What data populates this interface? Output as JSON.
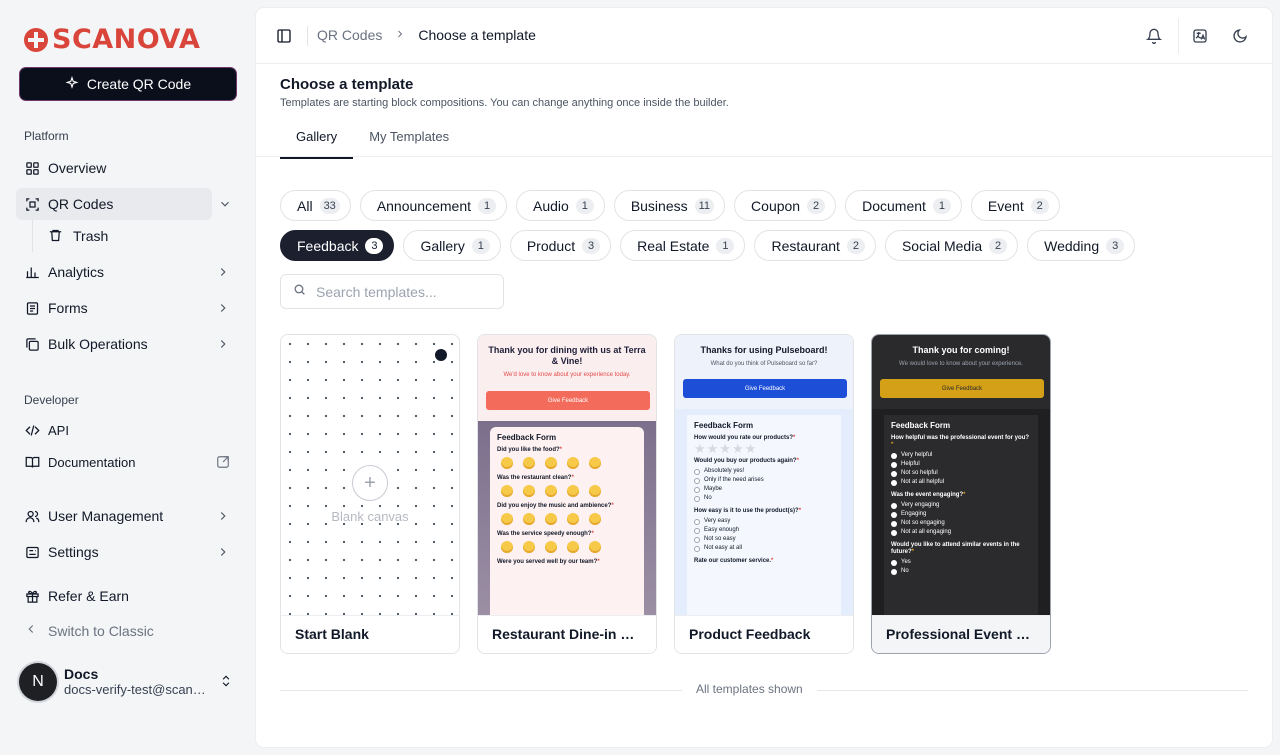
{
  "brand": {
    "name": "SCANOVA",
    "color": "#d9453a"
  },
  "sidebar": {
    "create_label": "Create QR Code",
    "platform_label": "Platform",
    "developer_label": "Developer",
    "items": {
      "overview": "Overview",
      "qr_codes": "QR Codes",
      "trash": "Trash",
      "analytics": "Analytics",
      "forms": "Forms",
      "bulk": "Bulk Operations",
      "api": "API",
      "docs": "Documentation",
      "users": "User Management",
      "settings": "Settings",
      "refer": "Refer & Earn",
      "switch": "Switch to Classic"
    },
    "user": {
      "initial": "N",
      "name": "Docs",
      "email": "docs-verify-test@scanova.io"
    }
  },
  "topbar": {
    "breadcrumb": {
      "parent": "QR Codes",
      "current": "Choose a template"
    }
  },
  "page": {
    "title": "Choose a template",
    "subtitle": "Templates are starting block compositions. You can change anything once inside the builder.",
    "tabs": [
      "Gallery",
      "My Templates"
    ]
  },
  "categories": [
    {
      "label": "All",
      "count": "33"
    },
    {
      "label": "Announcement",
      "count": "1"
    },
    {
      "label": "Audio",
      "count": "1"
    },
    {
      "label": "Business",
      "count": "11"
    },
    {
      "label": "Coupon",
      "count": "2"
    },
    {
      "label": "Document",
      "count": "1"
    },
    {
      "label": "Event",
      "count": "2"
    },
    {
      "label": "Feedback",
      "count": "3"
    },
    {
      "label": "Gallery",
      "count": "1"
    },
    {
      "label": "Product",
      "count": "3"
    },
    {
      "label": "Real Estate",
      "count": "1"
    },
    {
      "label": "Restaurant",
      "count": "2"
    },
    {
      "label": "Social Media",
      "count": "2"
    },
    {
      "label": "Wedding",
      "count": "3"
    }
  ],
  "search": {
    "placeholder": "Search templates..."
  },
  "cards": {
    "blank": {
      "name": "Start Blank",
      "label": "Blank canvas"
    },
    "restaurant": {
      "name": "Restaurant Dine-in Feedback",
      "title": "Thank you for dining with us at Terra & Vine!",
      "sub": "We'd love to know about your experience today.",
      "button": "Give Feedback",
      "form_title": "Feedback Form",
      "questions": [
        "Did you like the food?",
        "Was the restaurant clean?",
        "Did you enjoy the music and ambience?",
        "Was the service speedy enough?",
        "Were you served well by our team?"
      ],
      "accent": "#f26b5b"
    },
    "product": {
      "name": "Product Feedback",
      "title": "Thanks for using Pulseboard!",
      "sub": "What do you think of Pulseboard so far?",
      "button": "Give Feedback",
      "form_title": "Feedback Form",
      "q1": "How would you rate our products?",
      "q2": "Would you buy our products again?",
      "q2_opts": [
        "Absolutely yes!",
        "Only if the need arises",
        "Maybe",
        "No"
      ],
      "q3": "How easy is it to use the product(s)?",
      "q3_opts": [
        "Very easy",
        "Easy enough",
        "Not so easy",
        "Not easy at all"
      ],
      "q4": "Rate our customer service.",
      "accent": "#1d4ed8"
    },
    "event": {
      "name": "Professional Event Feedback",
      "title": "Thank you for coming!",
      "sub": "We would love to know about your experience.",
      "button": "Give Feedback",
      "form_title": "Feedback Form",
      "q1": "How helpful was the professional event for you?",
      "q1_opts": [
        "Very helpful",
        "Helpful",
        "Not so helpful",
        "Not at all helpful"
      ],
      "q2": "Was the event engaging?",
      "q2_opts": [
        "Very engaging",
        "Engaging",
        "Not so engaging",
        "Not at all engaging"
      ],
      "q3": "Would you like to attend similar events in the future?",
      "q3_opts": [
        "Yes",
        "No"
      ],
      "accent": "#d4a017"
    }
  },
  "footer": {
    "text": "All templates shown"
  }
}
